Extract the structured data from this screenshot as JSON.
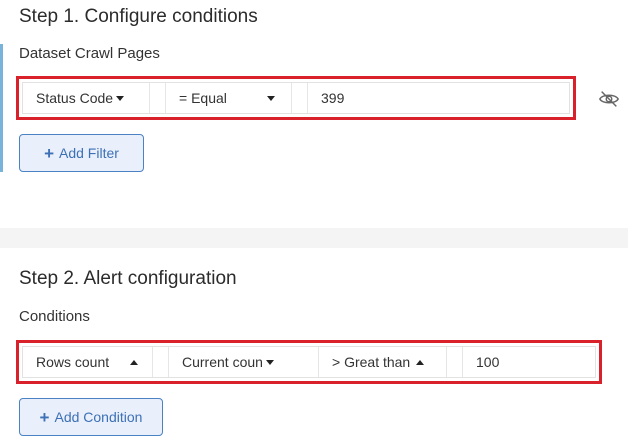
{
  "step1": {
    "title": "Step 1. Configure conditions",
    "dataset_label": "Dataset Crawl Pages",
    "filter": {
      "field": "Status Code",
      "operator": "= Equal",
      "value": "399"
    },
    "add_filter_label": "Add Filter",
    "visibility_icon": "eye-off-icon"
  },
  "step2": {
    "title": "Step 2. Alert configuration",
    "conditions_label": "Conditions",
    "condition": {
      "metric": "Rows count",
      "period": "Current coun",
      "operator": "> Great than",
      "value": "100"
    },
    "add_condition_label": "Add Condition"
  },
  "colors": {
    "highlight_border": "#d9212c",
    "accent": "#7ab3d9",
    "button_border": "#4a82c4",
    "button_text": "#3d70b6",
    "button_bg": "#e9f0fb"
  }
}
